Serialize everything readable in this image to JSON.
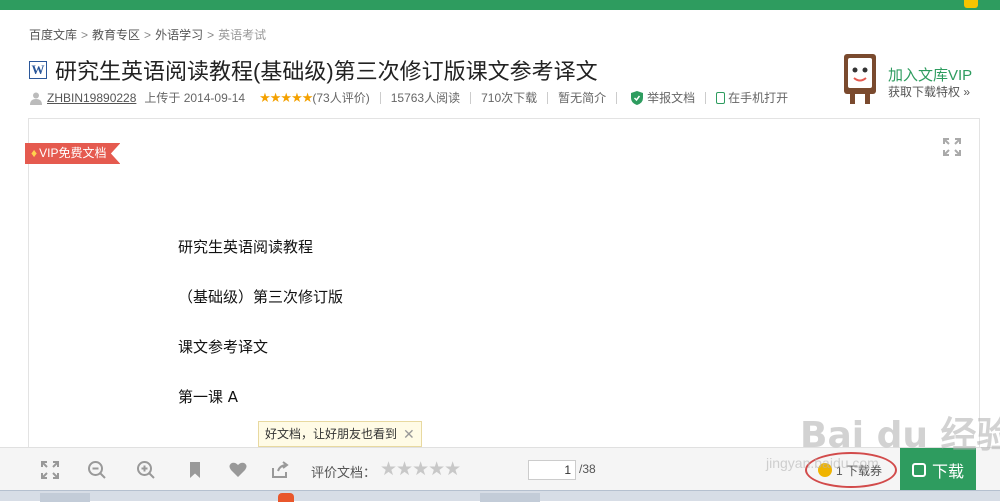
{
  "breadcrumb": {
    "items": [
      "百度文库",
      "教育专区",
      "外语学习",
      "英语考试"
    ],
    "separator": ">"
  },
  "document": {
    "type_icon": "W",
    "title": "研究生英语阅读教程(基础级)第三次修订版课文参考译文"
  },
  "meta": {
    "username": "ZHBIN19890228",
    "upload_text": "上传于 2014-09-14",
    "rating_stars": "★★★★★",
    "rating_value": 4.5,
    "rating_count": "(73人评价)",
    "reads": "15763人阅读",
    "downloads": "710次下载",
    "summary": "暂无简介",
    "report": "举报文档",
    "open_mobile": "在手机打开"
  },
  "vip_promo": {
    "title": "加入文库VIP",
    "subtitle": "获取下载特权 »"
  },
  "ribbon": {
    "label": "VIP免费文档"
  },
  "content": {
    "lines": [
      "研究生英语阅读教程",
      "（基础级）第三次修订版",
      "课文参考译文",
      "第一课 A"
    ]
  },
  "tooltip": {
    "text": "好文档，让好朋友也看到",
    "close": "✕"
  },
  "toolbar": {
    "rate_label": "评价文档：",
    "rate_stars": "★★★★★",
    "current_page": "1",
    "total_pages": "/38",
    "cost_label": "1 下载券",
    "download_label": "下载"
  },
  "watermark": {
    "brand": "Bai du 经验",
    "url": "jingyan.baidu.com"
  },
  "colors": {
    "brand_green": "#2e9c5f",
    "vip_red": "#e55a4f",
    "star_orange": "#f4a100"
  }
}
